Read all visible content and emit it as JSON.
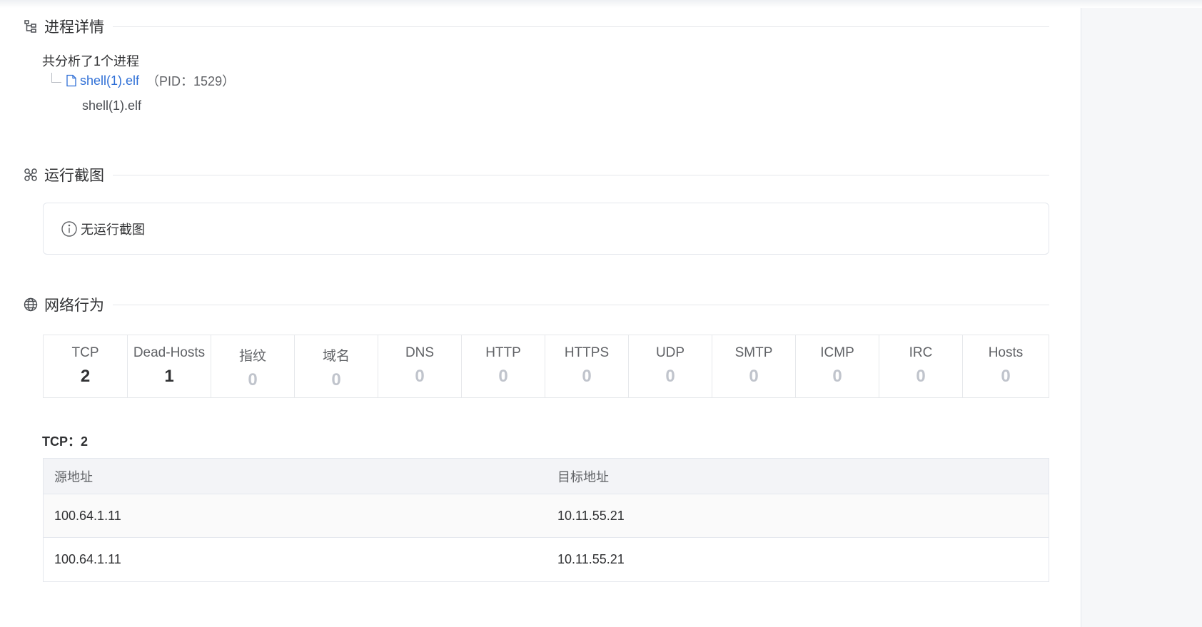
{
  "sections": {
    "process": {
      "title": "进程详情",
      "icon": "process-tree-icon"
    },
    "screenshot": {
      "title": "运行截图",
      "icon": "screenshot-icon"
    },
    "network": {
      "title": "网络行为",
      "icon": "globe-icon"
    }
  },
  "process": {
    "summary": "共分析了1个进程",
    "name": "shell(1).elf",
    "pid": "（PID：1529）",
    "command": "shell(1).elf"
  },
  "screenshot_empty": {
    "icon": "info-icon",
    "text": "无运行截图"
  },
  "network_stats": [
    {
      "label": "TCP",
      "value": "2"
    },
    {
      "label": "Dead-Hosts",
      "value": "1"
    },
    {
      "label": "指纹",
      "value": "0"
    },
    {
      "label": "域名",
      "value": "0"
    },
    {
      "label": "DNS",
      "value": "0"
    },
    {
      "label": "HTTP",
      "value": "0"
    },
    {
      "label": "HTTPS",
      "value": "0"
    },
    {
      "label": "UDP",
      "value": "0"
    },
    {
      "label": "SMTP",
      "value": "0"
    },
    {
      "label": "ICMP",
      "value": "0"
    },
    {
      "label": "IRC",
      "value": "0"
    },
    {
      "label": "Hosts",
      "value": "0"
    }
  ],
  "tcp": {
    "title": "TCP：2",
    "columns": [
      "源地址",
      "目标地址"
    ],
    "rows": [
      [
        "100.64.1.11",
        "10.11.55.21"
      ],
      [
        "100.64.1.11",
        "10.11.55.21"
      ]
    ]
  },
  "colors": {
    "link": "#2f6fd6",
    "text": "#303133",
    "muted": "#c0c4cc",
    "border": "#e4e7ed"
  }
}
